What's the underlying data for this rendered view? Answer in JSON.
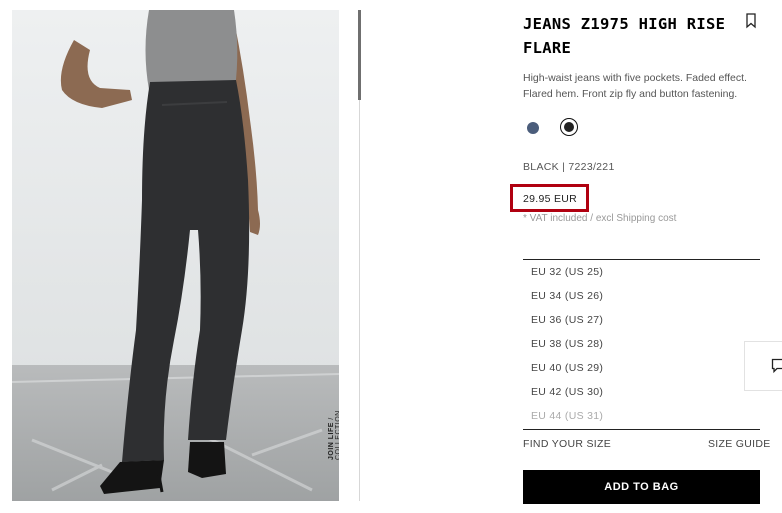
{
  "product": {
    "title": "JEANS Z1975 HIGH RISE FLARE",
    "description": "High-waist jeans with five pockets. Faded effect. Flared hem. Front zip fly and button fastening.",
    "color_ref": "BLACK | 7223/221",
    "price": "29.95 EUR",
    "vat_note": "* VAT included / excl Shipping cost"
  },
  "image_caption": {
    "brand": "JOIN LIFE",
    "suffix": " / COLLECTION"
  },
  "colors": [
    {
      "name": "blue",
      "hex": "#4b5d7b",
      "selected": false
    },
    {
      "name": "black",
      "hex": "#222222",
      "selected": true
    }
  ],
  "sizes": [
    {
      "label": "EU 32 (US 25)",
      "available": true
    },
    {
      "label": "EU 34 (US 26)",
      "available": true
    },
    {
      "label": "EU 36 (US 27)",
      "available": true
    },
    {
      "label": "EU 38 (US 28)",
      "available": true
    },
    {
      "label": "EU 40 (US 29)",
      "available": true
    },
    {
      "label": "EU 42 (US 30)",
      "available": true
    },
    {
      "label": "EU 44 (US 31)",
      "available": false
    }
  ],
  "links": {
    "find_your_size": "FIND YOUR SIZE",
    "size_guide": "SIZE GUIDE"
  },
  "buttons": {
    "add_to_bag": "ADD TO BAG"
  },
  "icons": {
    "bookmark": "bookmark-icon",
    "chat": "chat-icon"
  },
  "highlight_color": "#b00010"
}
